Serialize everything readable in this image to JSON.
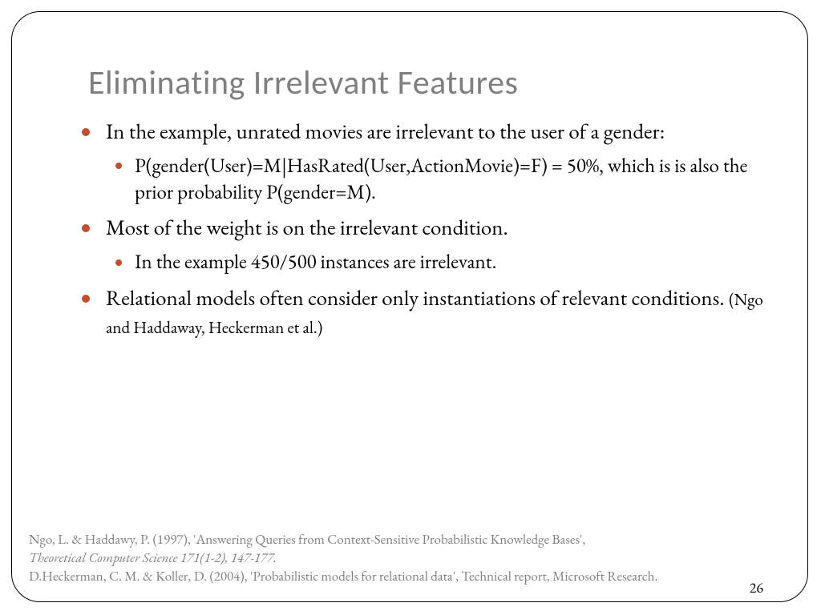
{
  "title": "Eliminating Irrelevant Features",
  "bullets": {
    "b1": "In the example, unrated movies are irrelevant to the user of a gender:",
    "b1s1": "P(gender(User)=M|HasRated(User,ActionMovie)=F) = 50%, which is is also the prior probability P(gender=M).",
    "b2": "Most of the weight is on the irrelevant condition.",
    "b2s1": "In the example 450/500 instances are irrelevant.",
    "b3a": "Relational models often consider only instantiations of relevant conditions. ",
    "b3b": "(Ngo and Haddaway, Heckerman et al.)"
  },
  "refs": {
    "r1a": "Ngo, L. & Haddawy, P. (1997), 'Answering Queries from Context-Sensitive Probabilistic Knowledge Bases', ",
    "r1b": "Theoretical Computer Science 171(1-2), 147-177.",
    "r2": "D.Heckerman, C. M. & Koller, D. (2004), 'Probabilistic models for relational data', Technical report, Microsoft Research."
  },
  "page": "26"
}
